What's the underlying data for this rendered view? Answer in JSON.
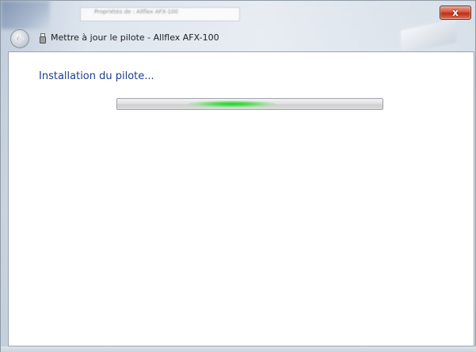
{
  "window": {
    "title": "Mettre à jour le pilote - Allflex AFX-100",
    "background_window_title": "Propriétés de : Allflex AFX-100",
    "close_glyph": "x",
    "back_icon": "back-arrow-icon",
    "title_icon": "usb-device-icon"
  },
  "main": {
    "heading": "Installation du pilote...",
    "progress": {
      "mode": "indeterminate",
      "marquee_position_fraction": 0.4,
      "color": "#21d12a"
    }
  },
  "colors": {
    "heading": "#1d3e8f",
    "close_button": "#c02b12"
  }
}
